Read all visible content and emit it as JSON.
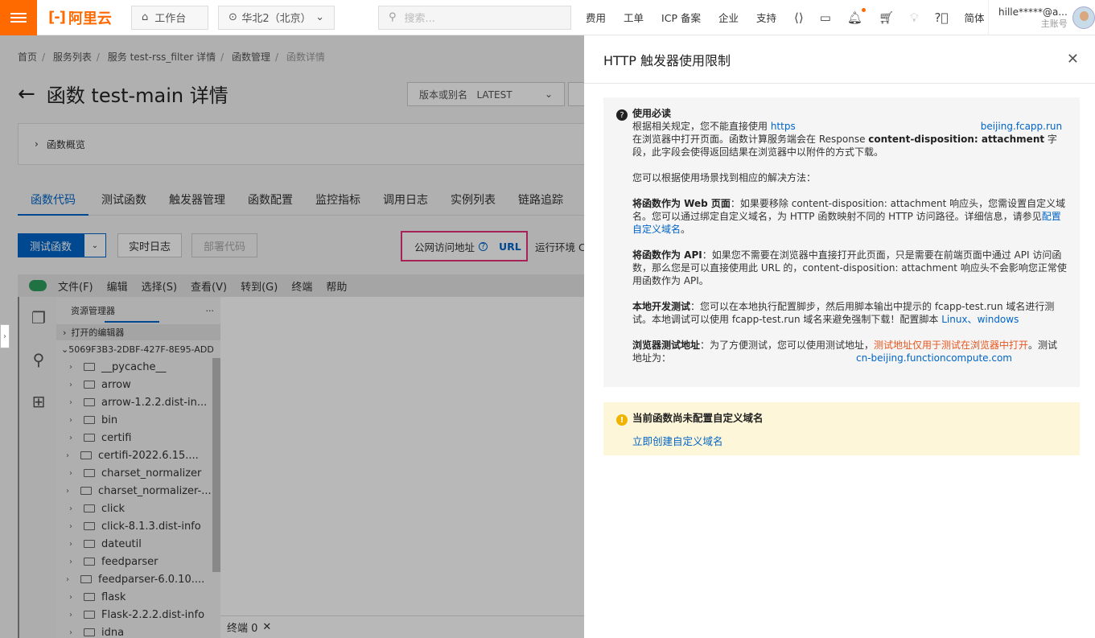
{
  "topbar": {
    "logo_text": "阿里云",
    "workbench": "工作台",
    "region": "华北2（北京）",
    "search_placeholder": "搜索...",
    "nav": [
      "费用",
      "工单",
      "ICP 备案",
      "企业",
      "支持"
    ],
    "lang": "简体",
    "account_name": "hille*****@a...",
    "account_sub": "主账号",
    "accent": "#ff6a00"
  },
  "breadcrumb": [
    "首页",
    "服务列表",
    "服务 test-rss_filter 详情",
    "函数管理",
    "函数详情"
  ],
  "page": {
    "title": "函数 test-main 详情",
    "version_label": "版本或别名",
    "version_value": "LATEST",
    "overview": "函数概览"
  },
  "tabs": [
    "函数代码",
    "测试函数",
    "触发器管理",
    "函数配置",
    "监控指标",
    "调用日志",
    "实例列表",
    "链路追踪"
  ],
  "actions": {
    "test": "测试函数",
    "realtime_log": "实时日志",
    "deploy": "部署代码",
    "public_url_label": "公网访问地址",
    "url": "URL",
    "runtime": "运行环境 C"
  },
  "ide": {
    "menu": [
      "文件(F)",
      "编辑",
      "选择(S)",
      "查看(V)",
      "转到(G)",
      "终端",
      "帮助"
    ],
    "explorer_title": "资源管理器",
    "open_editors": "打开的编辑器",
    "root": "5069F3B3-2DBF-427F-8E95-ADD",
    "tree": [
      {
        "name": "__pycache__",
        "deep": false
      },
      {
        "name": "arrow",
        "deep": false
      },
      {
        "name": "arrow-1.2.2.dist-in...",
        "deep": false
      },
      {
        "name": "bin",
        "deep": false
      },
      {
        "name": "certifi",
        "deep": false
      },
      {
        "name": "certifi-2022.6.15....",
        "deep": true
      },
      {
        "name": "charset_normalizer",
        "deep": false
      },
      {
        "name": "charset_normalizer-...",
        "deep": true
      },
      {
        "name": "click",
        "deep": false
      },
      {
        "name": "click-8.1.3.dist-info",
        "deep": false
      },
      {
        "name": "dateutil",
        "deep": false
      },
      {
        "name": "feedparser",
        "deep": false
      },
      {
        "name": "feedparser-6.0.10....",
        "deep": true
      },
      {
        "name": "flask",
        "deep": false
      },
      {
        "name": "Flask-2.2.2.dist-info",
        "deep": false
      },
      {
        "name": "idna",
        "deep": false
      }
    ],
    "terminal_tab": "终端 0"
  },
  "drawer": {
    "title": "HTTP 触发器使用限制",
    "notice_title": "使用必读",
    "p1_a": "根据相关规定，您不能直接使用 ",
    "p1_link_start": "https",
    "p1_link_end": "beijing.fcapp.run",
    "p1_b": "在浏览器中打开页面。函数计算服务端会在 Response ",
    "p1_c": "content-disposition: attachment",
    "p1_d": " 字段，此字段会使得返回结果在浏览器中以附件的方式下载。",
    "p2": "您可以根据使用场景找到相应的解决方法：",
    "p3_bold": "将函数作为 Web 页面",
    "p3_text": "：如果要移除 content-disposition: attachment 响应头，您需设置自定义域名。您可以通过绑定自定义域名，为 HTTP 函数映射不同的 HTTP 访问路径。详细信息，请参见",
    "p3_link": "配置自定义域名",
    "p3_end": "。",
    "p4_bold": "将函数作为 API",
    "p4_text": "：如果您不需要在浏览器中直接打开此页面，只是需要在前端页面中通过 API 访问函数，那么您是可以直接使用此 URL 的，content-disposition: attachment 响应头不会影响您正常使用函数作为 API。",
    "p5_bold": "本地开发测试",
    "p5_text": "：您可以在本地执行配置脚步，然后用脚本输出中提示的 fcapp-test.run 域名进行测试。本地调试可以使用 fcapp-test.run 域名来避免强制下载！配置脚本 ",
    "p5_link1": "Linux",
    "p5_sep": "、",
    "p5_link2": "windows",
    "p6_bold": "浏览器测试地址",
    "p6_text": "：为了方便测试，您可以使用测试地址，",
    "p6_red": "测试地址仅用于测试在浏览器中打开",
    "p6_end": "。测试地址为：",
    "p6_link": "cn-beijing.functioncompute.com",
    "warn_title": "当前函数尚未配置自定义域名",
    "warn_link": "立即创建自定义域名"
  }
}
